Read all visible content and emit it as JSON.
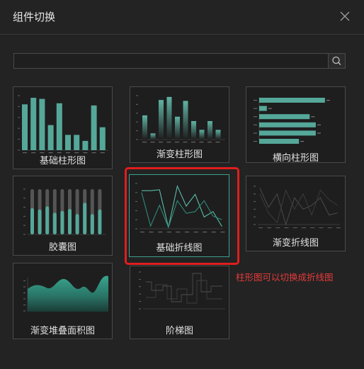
{
  "dialog": {
    "title": "组件切换",
    "search": {
      "value": "",
      "placeholder": ""
    }
  },
  "cards": [
    {
      "id": "basic-bar",
      "label": "基础柱形图",
      "selected": false
    },
    {
      "id": "gradient-bar",
      "label": "渐变柱形图",
      "selected": false
    },
    {
      "id": "horizontal-bar",
      "label": "横向柱形图",
      "selected": false
    },
    {
      "id": "capsule",
      "label": "胶囊图",
      "selected": false
    },
    {
      "id": "basic-line",
      "label": "基础折线图",
      "selected": true
    },
    {
      "id": "gradient-line",
      "label": "渐变折线图",
      "selected": false
    },
    {
      "id": "gradient-stacked-area",
      "label": "渐变堆叠面积图",
      "selected": false
    },
    {
      "id": "step",
      "label": "阶梯图",
      "selected": false
    }
  ],
  "annotation": {
    "text": "柱形图可以切换成折线图"
  },
  "colors": {
    "accent": "#3e9f8e",
    "bar": "#55a899",
    "highlight": "#e11d1d"
  },
  "icons": {
    "close": "close-icon",
    "search": "search-icon"
  }
}
